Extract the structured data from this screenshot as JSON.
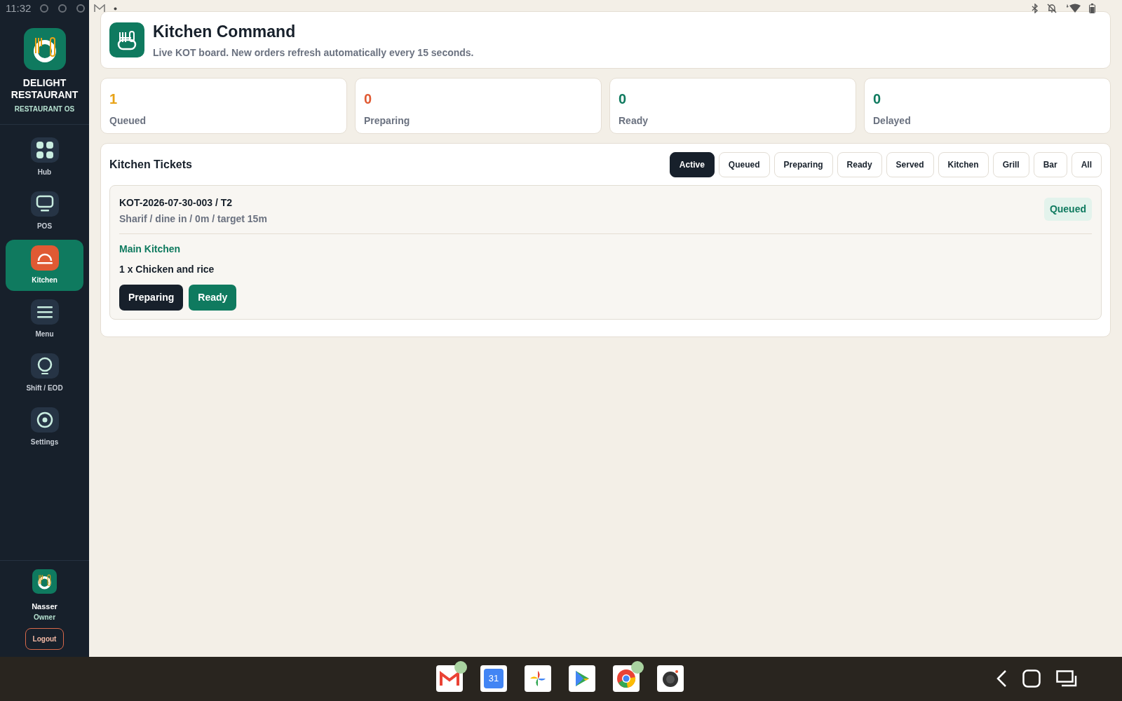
{
  "status_bar": {
    "time": "11:32"
  },
  "sidebar": {
    "brand": "DELIGHT RESTAURANT",
    "subtitle": "RESTAURANT OS",
    "items": [
      {
        "label": "Hub",
        "kind": "grid",
        "selected": false
      },
      {
        "label": "POS",
        "kind": "monitor",
        "selected": false
      },
      {
        "label": "Kitchen",
        "kind": "cloche",
        "selected": true
      },
      {
        "label": "Menu",
        "kind": "lines",
        "selected": false
      },
      {
        "label": "Shift / EOD",
        "kind": "ring",
        "selected": false
      },
      {
        "label": "Settings",
        "kind": "target",
        "selected": false
      }
    ],
    "user": {
      "name": "Nasser",
      "role": "Owner",
      "logout": "Logout"
    }
  },
  "header": {
    "title": "Kitchen Command",
    "subtitle": "Live KOT board. New orders refresh automatically every 15 seconds."
  },
  "stats": [
    {
      "value": "1",
      "label": "Queued",
      "color": "#e8a317"
    },
    {
      "value": "0",
      "label": "Preparing",
      "color": "#e05a33"
    },
    {
      "value": "0",
      "label": "Ready",
      "color": "#0f7a5f"
    },
    {
      "value": "0",
      "label": "Delayed",
      "color": "#0f7a5f"
    }
  ],
  "tickets": {
    "title": "Kitchen Tickets",
    "filters": [
      {
        "label": "Active",
        "selected": true
      },
      {
        "label": "Queued",
        "selected": false
      },
      {
        "label": "Preparing",
        "selected": false
      },
      {
        "label": "Ready",
        "selected": false
      },
      {
        "label": "Served",
        "selected": false
      },
      {
        "label": "Kitchen",
        "selected": false
      },
      {
        "label": "Grill",
        "selected": false
      },
      {
        "label": "Bar",
        "selected": false
      },
      {
        "label": "All",
        "selected": false
      }
    ],
    "items": [
      {
        "id": "KOT-2026-07-30-003 / T2",
        "meta": "Sharif / dine in / 0m / target 15m",
        "status": "Queued",
        "station": "Main Kitchen",
        "lines": [
          "1 x Chicken and rice"
        ],
        "actions": [
          {
            "label": "Preparing",
            "kind": "dark"
          },
          {
            "label": "Ready",
            "kind": "green"
          }
        ]
      }
    ]
  },
  "taskbar": {
    "calendar_day": "31"
  }
}
